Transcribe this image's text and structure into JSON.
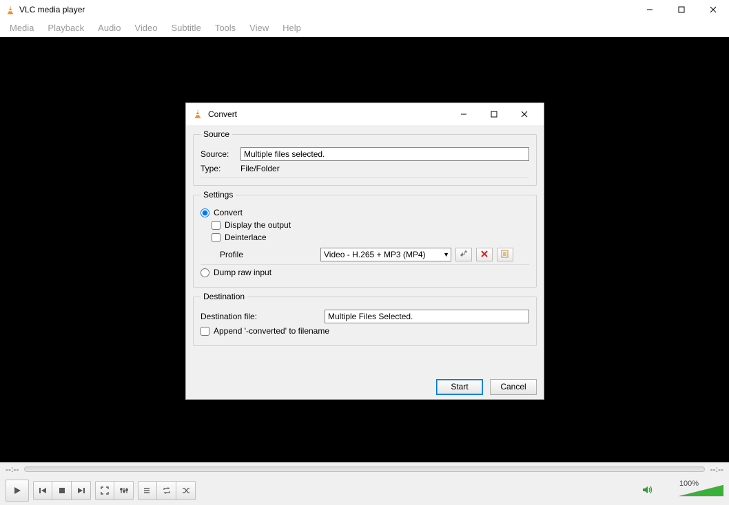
{
  "main": {
    "title": "VLC media player",
    "menu": [
      "Media",
      "Playback",
      "Audio",
      "Video",
      "Subtitle",
      "Tools",
      "View",
      "Help"
    ],
    "time_left": "--:--",
    "time_right": "--:--",
    "volume_pct": "100%"
  },
  "dialog": {
    "title": "Convert",
    "groups": {
      "source": {
        "legend": "Source",
        "source_label": "Source:",
        "source_value": "Multiple files selected.",
        "type_label": "Type:",
        "type_value": "File/Folder"
      },
      "settings": {
        "legend": "Settings",
        "convert_label": "Convert",
        "display_output_label": "Display the output",
        "deinterlace_label": "Deinterlace",
        "profile_label": "Profile",
        "profile_value": "Video - H.265 + MP3 (MP4)",
        "dump_label": "Dump raw input"
      },
      "destination": {
        "legend": "Destination",
        "dest_file_label": "Destination file:",
        "dest_file_value": "Multiple Files Selected.",
        "append_label": "Append '-converted' to filename"
      }
    },
    "buttons": {
      "start": "Start",
      "cancel": "Cancel"
    }
  }
}
